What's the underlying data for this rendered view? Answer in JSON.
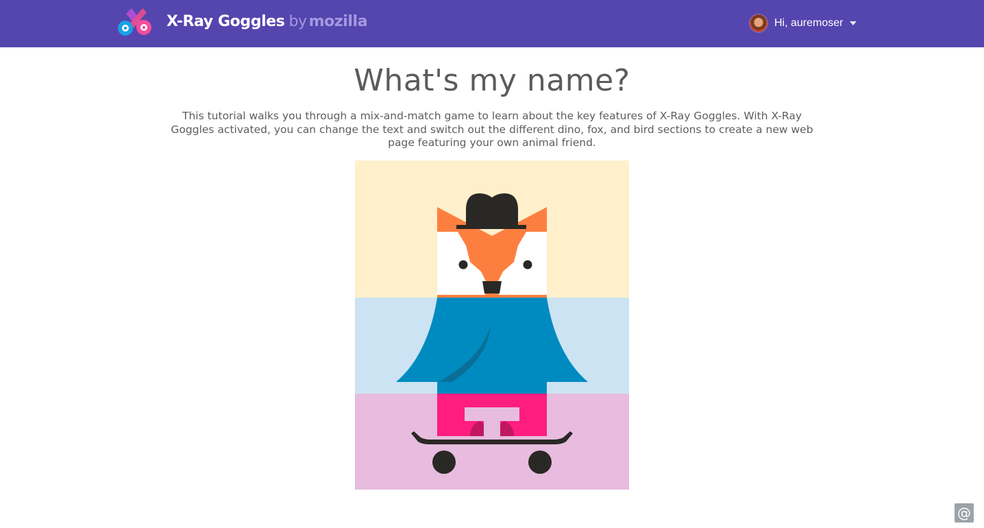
{
  "header": {
    "app_name": "X-Ray Goggles",
    "by": "by",
    "maker": "mozilla",
    "logo_icon": "goggles-logo-icon",
    "greeting": "Hi, auremoser",
    "dropdown_icon": "caret-down-icon",
    "background_color": "#5545ae"
  },
  "main": {
    "title": "What's my name?",
    "intro": "This tutorial walks you through a mix-and-match game to learn about the key features of X-Ray Goggles. With X-Ray Goggles activated, you can change the text and switch out the different dino, fox, and bird sections to create a new web page featuring your own animal friend."
  },
  "animal": {
    "sections": [
      "head",
      "body",
      "legs"
    ],
    "head": {
      "animal": "fox",
      "background": "#fff0cb"
    },
    "body": {
      "animal": "bird",
      "background": "#cce3f3"
    },
    "legs": {
      "vehicle": "skateboard",
      "background": "#e7bcdf"
    },
    "colors": {
      "fox_orange": "#fd7f40",
      "bird_blue": "#008bc0",
      "pants_pink": "#ff1d7f",
      "dark": "#2a2825"
    }
  },
  "chat": {
    "icon": "at-sign-icon",
    "label": "@"
  }
}
